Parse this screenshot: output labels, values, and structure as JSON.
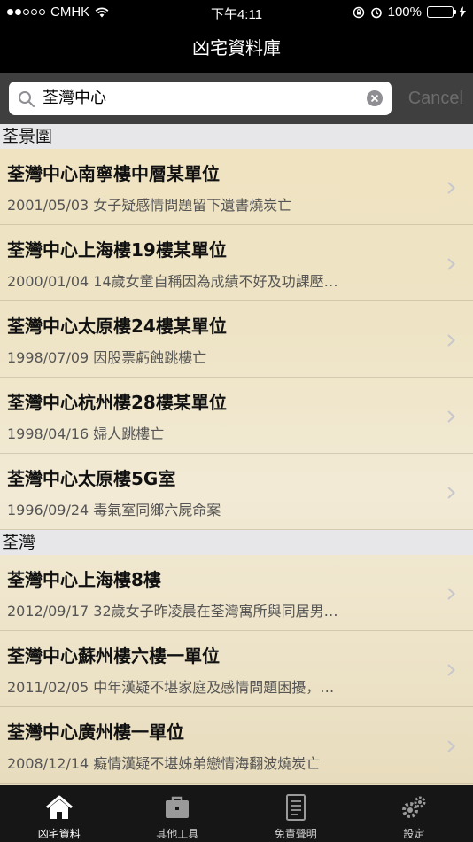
{
  "status": {
    "carrier": "CMHK",
    "time": "下午4:11",
    "battery": "100%"
  },
  "nav": {
    "title": "凶宅資料庫"
  },
  "search": {
    "value": "荃灣中心",
    "cancel": "Cancel"
  },
  "sections": [
    {
      "header": "荃景圍",
      "items": [
        {
          "title": "荃灣中心南寧樓中層某單位",
          "sub": "2001/05/03 女子疑感情問題留下遺書燒炭亡"
        },
        {
          "title": "荃灣中心上海樓19樓某單位",
          "sub": "2000/01/04 14歲女童自稱因為成績不好及功課壓…"
        },
        {
          "title": "荃灣中心太原樓24樓某單位",
          "sub": "1998/07/09 因股票虧蝕跳樓亡"
        },
        {
          "title": "荃灣中心杭州樓28樓某單位",
          "sub": "1998/04/16 婦人跳樓亡"
        },
        {
          "title": "荃灣中心太原樓5G室",
          "sub": "1996/09/24 毒氣室同鄉六屍命案"
        }
      ]
    },
    {
      "header": "荃灣",
      "items": [
        {
          "title": "荃灣中心上海樓8樓",
          "sub": "2012/09/17 32歲女子昨凌晨在荃灣寓所與同居男…"
        },
        {
          "title": "荃灣中心蘇州樓六樓一單位",
          "sub": "2011/02/05 中年漢疑不堪家庭及感情問題困擾，…"
        },
        {
          "title": "荃灣中心廣州樓一單位",
          "sub": "2008/12/14 癡情漢疑不堪姊弟戀情海翻波燒炭亡"
        }
      ]
    }
  ],
  "tabs": [
    {
      "label": "凶宅資料",
      "icon": "home-icon"
    },
    {
      "label": "其他工具",
      "icon": "briefcase-icon"
    },
    {
      "label": "免責聲明",
      "icon": "document-icon"
    },
    {
      "label": "設定",
      "icon": "gears-icon"
    }
  ]
}
